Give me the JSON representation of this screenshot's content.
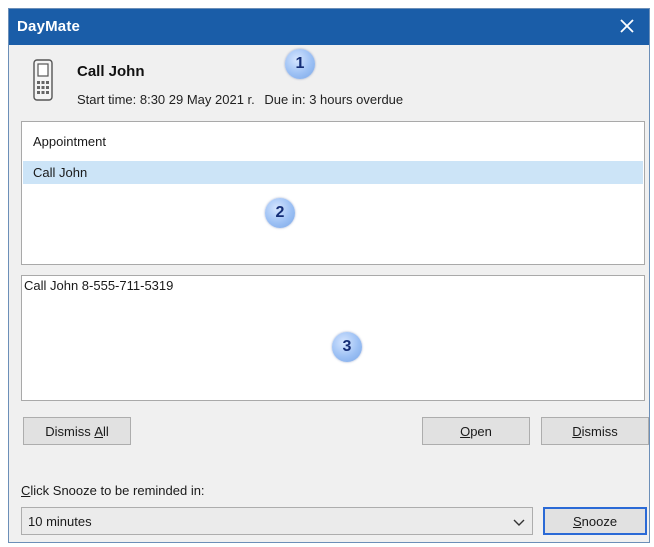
{
  "window": {
    "title": "DayMate",
    "close_glyph": "✕"
  },
  "reminder": {
    "icon": "phone-icon",
    "subject": "Call John",
    "start_time": "Start time: 8:30  29 May 2021 r.",
    "due_in": "Due in: 3 hours overdue"
  },
  "list": {
    "items": [
      {
        "label": "Appointment"
      },
      {
        "label": "Call John",
        "selected": true
      }
    ]
  },
  "notes": {
    "text": "Call John 8-555-711-5319"
  },
  "badges": [
    "1",
    "2",
    "3"
  ],
  "buttons": {
    "dismiss_all": {
      "pre": "Dismiss ",
      "key": "A",
      "post": "ll"
    },
    "open": {
      "pre": "",
      "key": "O",
      "post": "pen"
    },
    "dismiss": {
      "pre": "",
      "key": "D",
      "post": "ismiss"
    },
    "snooze": {
      "pre": "",
      "key": "S",
      "post": "nooze"
    }
  },
  "snooze": {
    "label_key": "C",
    "label_rest": "lick Snooze to be reminded in:",
    "selected": "10 minutes"
  },
  "colors": {
    "title_bar": "#1a5da8",
    "selection": "#cce4f7",
    "badge": "#9cc0f4",
    "default_button_border": "#2b6ad6"
  }
}
